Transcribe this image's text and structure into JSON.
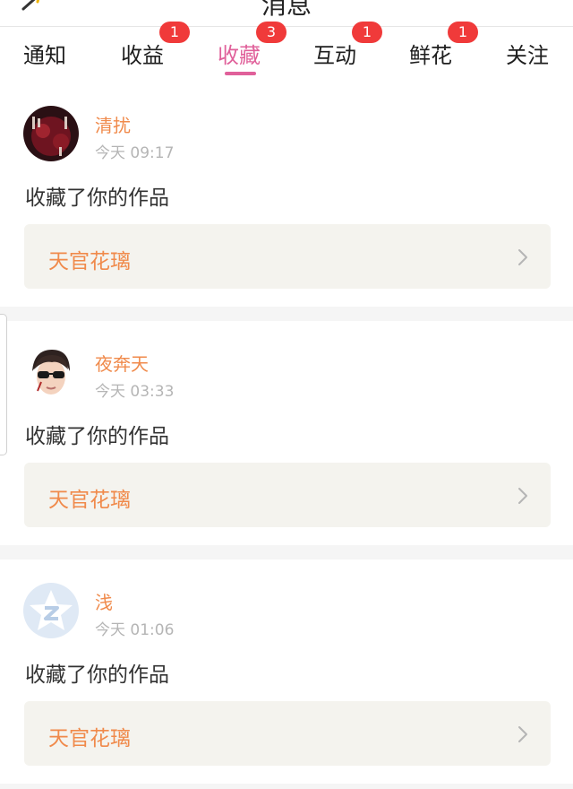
{
  "header": {
    "title": "消息",
    "back_icon": "back-arrow-icon"
  },
  "tabs": [
    {
      "label": "通知",
      "badge": ""
    },
    {
      "label": "收益",
      "badge": "1"
    },
    {
      "label": "收藏",
      "badge": "3",
      "active": true
    },
    {
      "label": "互动",
      "badge": "1"
    },
    {
      "label": "鲜花",
      "badge": "1"
    },
    {
      "label": "关注",
      "badge": ""
    }
  ],
  "colors": {
    "accent": "#e0609a",
    "username": "#f08a4b",
    "badge": "#f03a3a",
    "work_box_bg": "#f4f3ee"
  },
  "feed": [
    {
      "user": "清扰",
      "time": "今天 09:17",
      "action": "收藏了你的作品",
      "work": "天官花璃",
      "avatar_icon": "dark-red-art-avatar"
    },
    {
      "user": "夜奔天",
      "time": "今天 03:33",
      "action": "收藏了你的作品",
      "work": "天官花璃",
      "avatar_icon": "person-sunglasses-avatar"
    },
    {
      "user": "浅",
      "time": "今天 01:06",
      "action": "收藏了你的作品",
      "work": "天官花璃",
      "avatar_icon": "default-star-avatar"
    }
  ]
}
